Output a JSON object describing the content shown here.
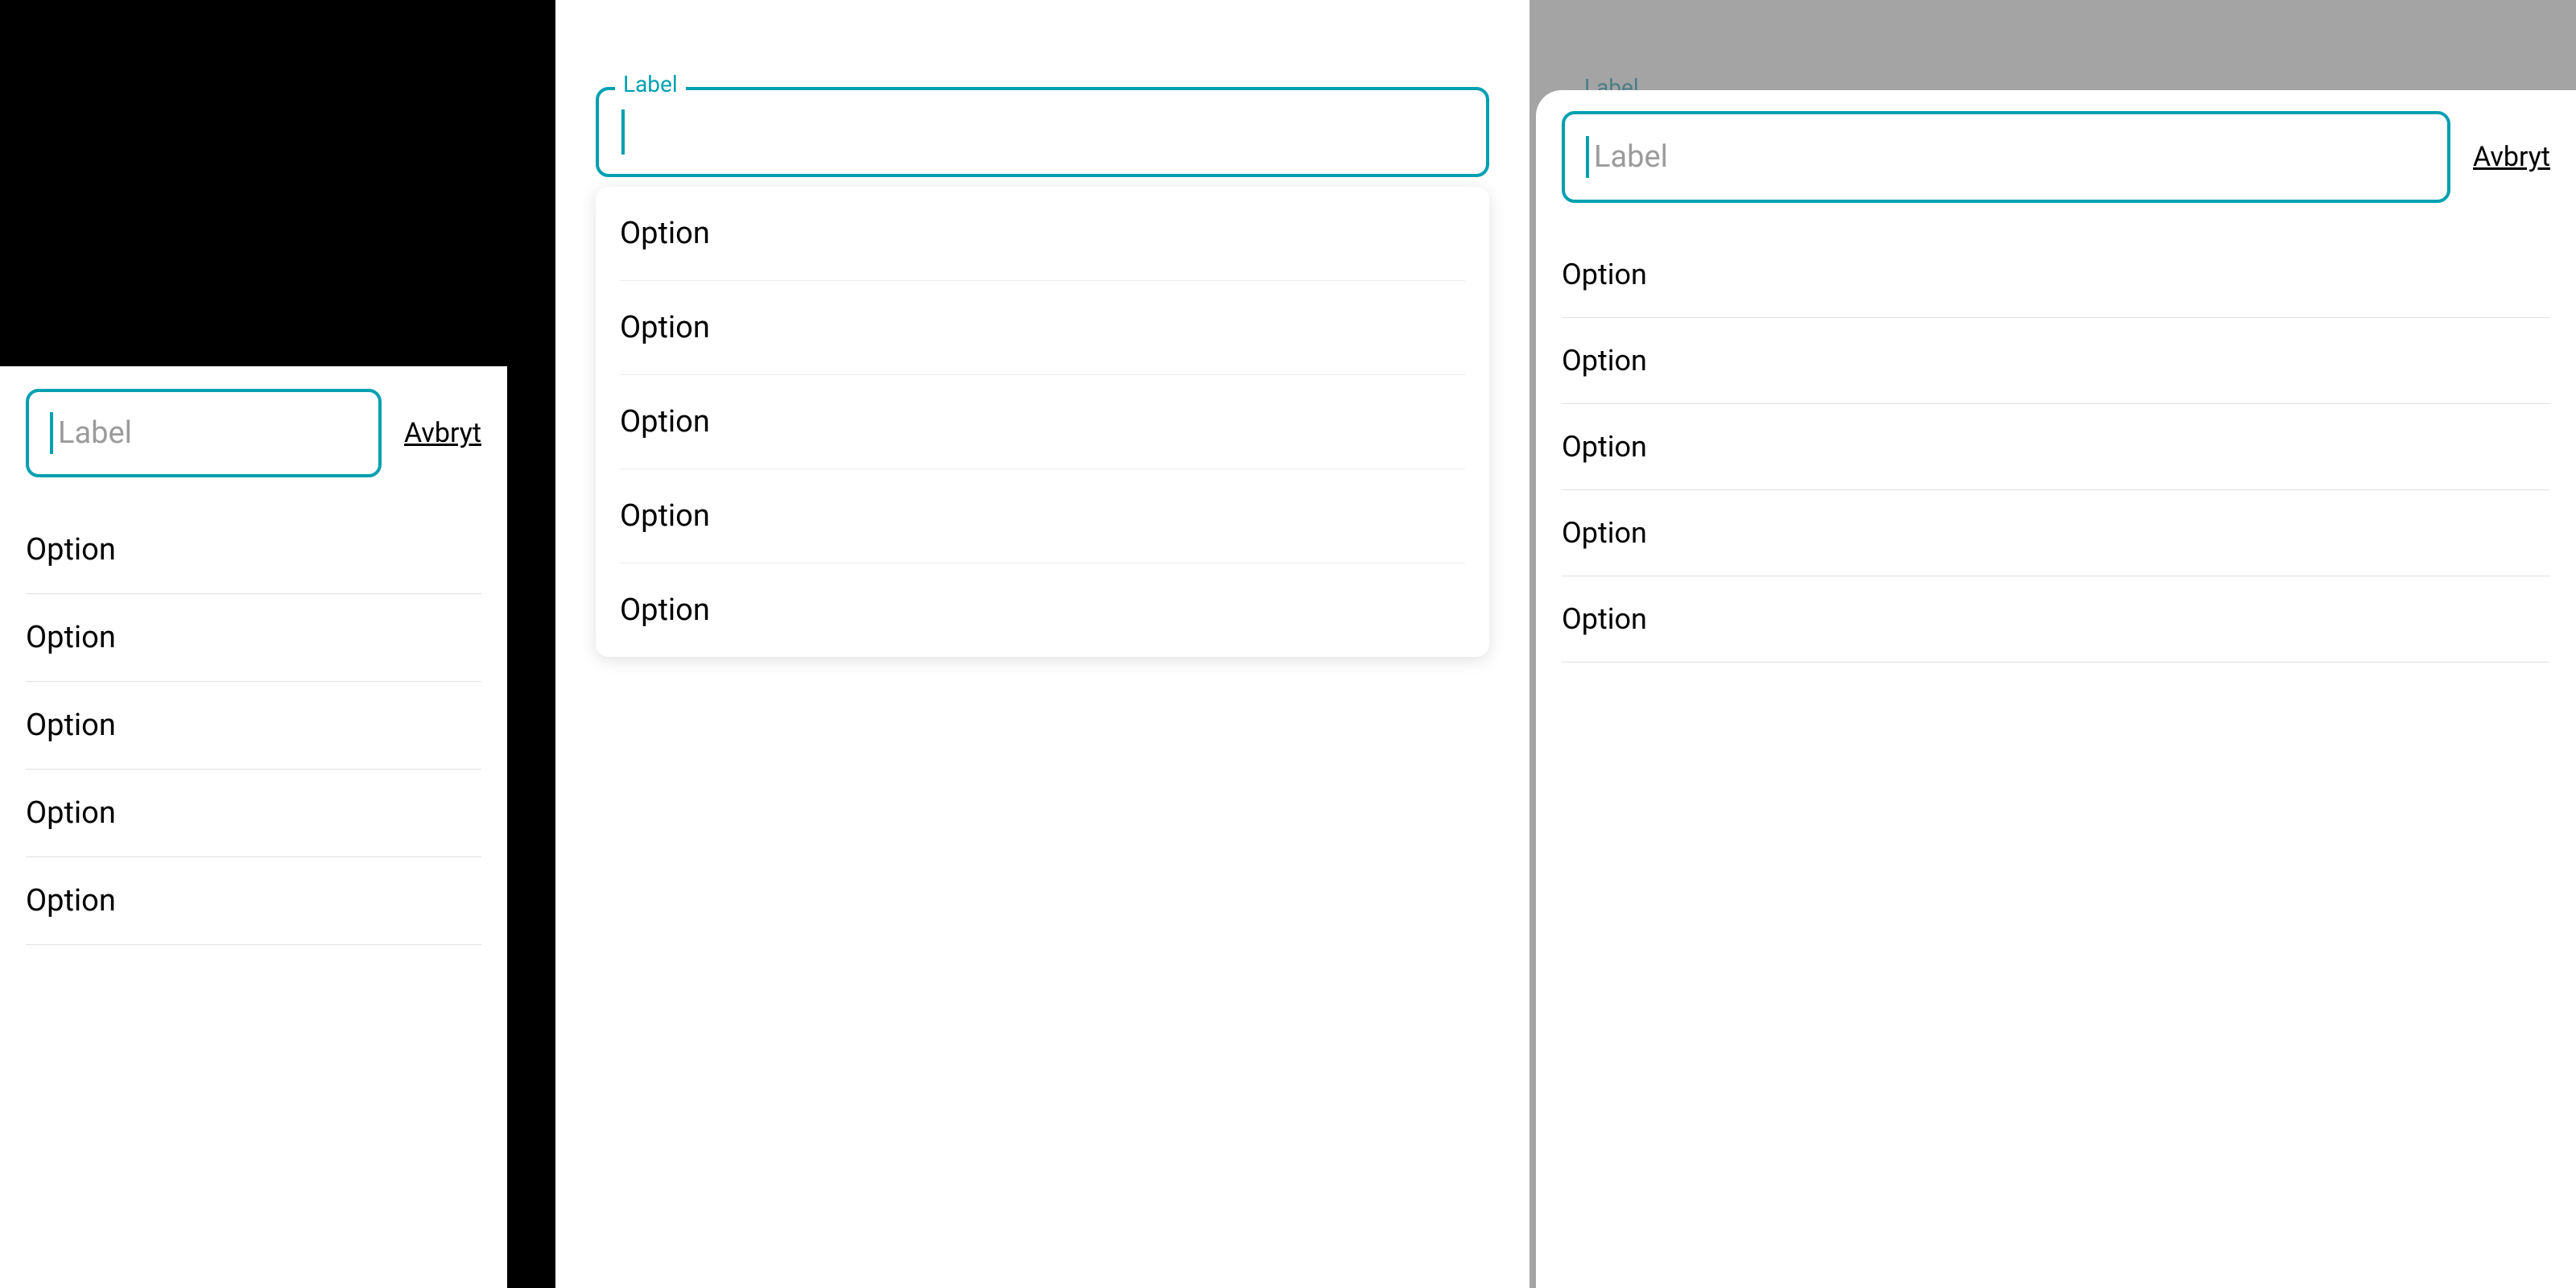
{
  "colors": {
    "accent": "#00a0b0"
  },
  "left_sheet": {
    "input_placeholder": "Label",
    "cancel_label": "Avbryt",
    "options": [
      "Option",
      "Option",
      "Option",
      "Option",
      "Option"
    ]
  },
  "mid_panel": {
    "floating_label": "Label",
    "options": [
      "Option",
      "Option",
      "Option",
      "Option",
      "Option"
    ]
  },
  "right_sheet": {
    "behind_floating_label": "Label",
    "input_placeholder": "Label",
    "cancel_label": "Avbryt",
    "options": [
      "Option",
      "Option",
      "Option",
      "Option",
      "Option"
    ]
  }
}
